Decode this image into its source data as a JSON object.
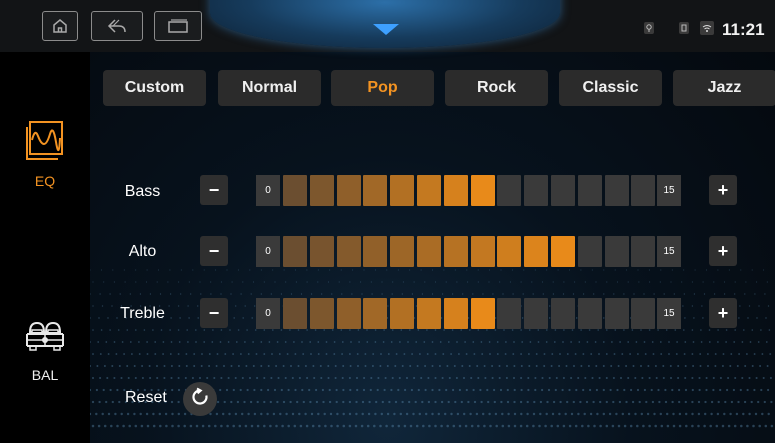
{
  "status_bar": {
    "clock": "11:21",
    "icons": [
      "home-icon",
      "back-icon",
      "recent-apps-icon",
      "dropdown-arrow-icon",
      "location-icon",
      "usb-icon",
      "wifi-icon"
    ]
  },
  "sidebar": {
    "items": [
      {
        "label": "EQ",
        "icon": "equalizer-wave-icon",
        "active": true
      },
      {
        "label": "BAL",
        "icon": "balance-car-seats-icon",
        "active": false
      }
    ]
  },
  "presets": {
    "tabs": [
      "Custom",
      "Normal",
      "Pop",
      "Rock",
      "Classic",
      "Jazz"
    ],
    "selected": "Pop"
  },
  "equalizer": {
    "min_label": "0",
    "max_label": "15",
    "segments": 14,
    "minus": "−",
    "plus": "+",
    "bands": [
      {
        "label": "Bass",
        "level": 8
      },
      {
        "label": "Alto",
        "level": 11
      },
      {
        "label": "Treble",
        "level": 8
      }
    ]
  },
  "reset": {
    "label": "Reset",
    "icon": "refresh-icon"
  },
  "colors": {
    "accent": "#f39322",
    "active_segment_start": "#6b4e30",
    "active_segment_end": "#e88a1a",
    "inactive_segment": "#3a3a3a"
  }
}
